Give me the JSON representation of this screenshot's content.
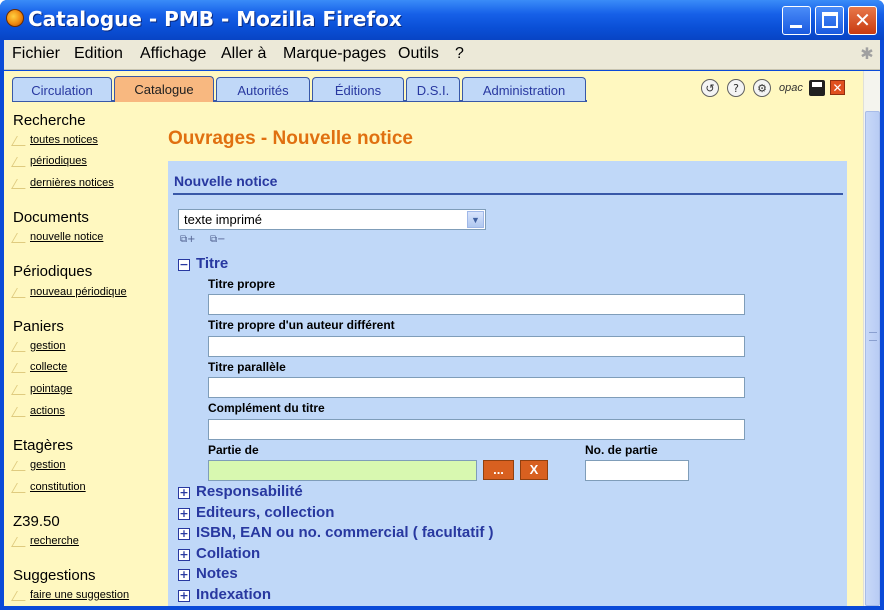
{
  "window": {
    "title": "Catalogue - PMB - Mozilla Firefox"
  },
  "menubar": {
    "items": [
      {
        "label": "Fichier"
      },
      {
        "label": "Edition"
      },
      {
        "label": "Affichage"
      },
      {
        "label": "Aller à"
      },
      {
        "label": "Marque-pages"
      },
      {
        "label": "Outils"
      },
      {
        "label": "?"
      }
    ]
  },
  "tabs": [
    {
      "label": "Circulation",
      "active": false
    },
    {
      "label": "Catalogue",
      "active": true
    },
    {
      "label": "Autorités",
      "active": false
    },
    {
      "label": "Éditions",
      "active": false
    },
    {
      "label": "D.S.I.",
      "active": false
    },
    {
      "label": "Administration",
      "active": false
    }
  ],
  "toolbar_icons": [
    {
      "name": "history-icon",
      "glyph": "↺"
    },
    {
      "name": "help-icon",
      "glyph": "?"
    },
    {
      "name": "settings-icon",
      "glyph": "⚙"
    },
    {
      "name": "opac-link",
      "glyph": "opac"
    },
    {
      "name": "save-icon",
      "glyph": ""
    },
    {
      "name": "logout-icon",
      "glyph": "✕"
    }
  ],
  "sidebar": {
    "sections": [
      {
        "heading": "Recherche",
        "links": [
          "toutes notices",
          "périodiques",
          "dernières notices"
        ]
      },
      {
        "heading": "Documents",
        "links": [
          "nouvelle notice"
        ]
      },
      {
        "heading": "Périodiques",
        "links": [
          "nouveau périodique"
        ]
      },
      {
        "heading": "Paniers",
        "links": [
          "gestion",
          "collecte",
          "pointage",
          "actions"
        ]
      },
      {
        "heading": "Etagères",
        "links": [
          "gestion",
          "constitution"
        ]
      },
      {
        "heading": "Z39.50",
        "links": [
          "recherche"
        ]
      },
      {
        "heading": "Suggestions",
        "links": [
          "faire une suggestion"
        ]
      }
    ]
  },
  "main": {
    "page_title": "Ouvrages - Nouvelle notice",
    "panel_title": "Nouvelle notice",
    "doc_type_value": "texte imprimé",
    "titre_section": {
      "label": "Titre",
      "toggle": "−",
      "fields": [
        {
          "label": "Titre propre",
          "value": ""
        },
        {
          "label": "Titre propre d'un auteur différent",
          "value": ""
        },
        {
          "label": "Titre parallèle",
          "value": ""
        },
        {
          "label": "Complément du titre",
          "value": ""
        }
      ],
      "partie_de_label": "Partie de",
      "partie_de_value": "",
      "select_button": "...",
      "clear_button": "X",
      "no_partie_label": "No. de partie",
      "no_partie_value": ""
    },
    "collapsed_sections": [
      {
        "label": "Responsabilité",
        "toggle": "+"
      },
      {
        "label": "Editeurs, collection",
        "toggle": "+"
      },
      {
        "label": "ISBN, EAN ou no. commercial ( facultatif )",
        "toggle": "+"
      },
      {
        "label": "Collation",
        "toggle": "+"
      },
      {
        "label": "Notes",
        "toggle": "+"
      },
      {
        "label": "Indexation",
        "toggle": "+"
      }
    ]
  }
}
